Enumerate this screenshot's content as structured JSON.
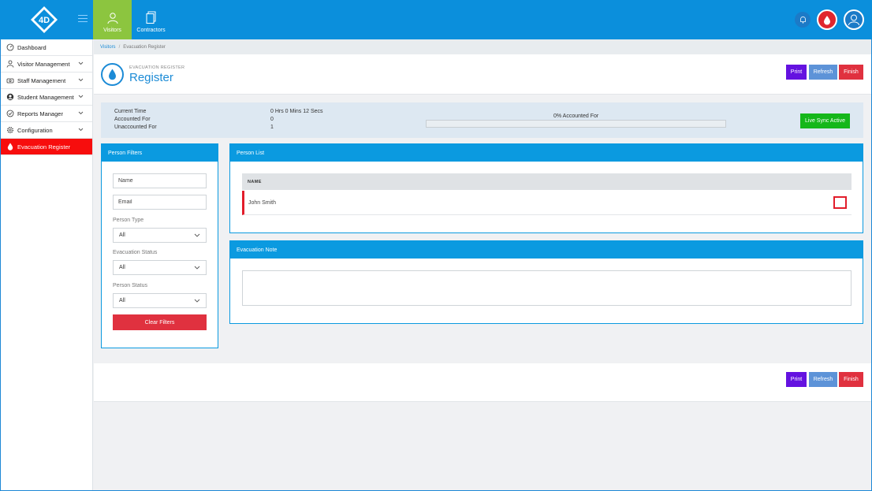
{
  "topnav": {
    "items": [
      {
        "label": "Visitors",
        "icon": "visitor-icon",
        "active": true
      },
      {
        "label": "Contractors",
        "icon": "document-icon",
        "active": false
      }
    ]
  },
  "sidebar": {
    "items": [
      {
        "label": "Dashboard",
        "icon": "dashboard-icon"
      },
      {
        "label": "Visitor Management",
        "icon": "person-icon"
      },
      {
        "label": "Staff Management",
        "icon": "staff-icon"
      },
      {
        "label": "Student Management",
        "icon": "student-icon"
      },
      {
        "label": "Reports Manager",
        "icon": "reports-icon"
      },
      {
        "label": "Configuration",
        "icon": "gear-icon"
      },
      {
        "label": "Evacuation Register",
        "icon": "drop-icon"
      }
    ]
  },
  "breadcrumb": {
    "link": "Visitors",
    "separator": "/",
    "current": "Evacuation Register"
  },
  "header": {
    "subtitle": "EVACUATION REGISTER",
    "title": "Register"
  },
  "actions": {
    "print": "Print",
    "refresh": "Refresh",
    "finish": "Finish"
  },
  "stats": {
    "current_time_label": "Current Time",
    "current_time_value": "0 Hrs 0 Mins 12 Secs",
    "accounted_label": "Accounted For",
    "accounted_value": "0",
    "unaccounted_label": "Unaccounted For",
    "unaccounted_value": "1",
    "progress_text": "0% Accounted For",
    "progress_percent": 0,
    "live_sync": "Live Sync Active"
  },
  "filters": {
    "title": "Person Filters",
    "name_placeholder": "Name",
    "email_placeholder": "Email",
    "person_type_label": "Person Type",
    "person_type_value": "All",
    "evac_status_label": "Evacuation Status",
    "evac_status_value": "All",
    "person_status_label": "Person Status",
    "person_status_value": "All",
    "clear_button": "Clear Filters"
  },
  "person_list": {
    "title": "Person List",
    "column_name": "NAME",
    "rows": [
      {
        "name": "John Smith"
      }
    ]
  },
  "evacuation_note": {
    "title": "Evacuation Note"
  },
  "colors": {
    "brand": "#0b8fdc",
    "accent": "#0b9ae0",
    "danger": "#e0313f",
    "success": "#15b71a",
    "print": "#6412e0"
  }
}
